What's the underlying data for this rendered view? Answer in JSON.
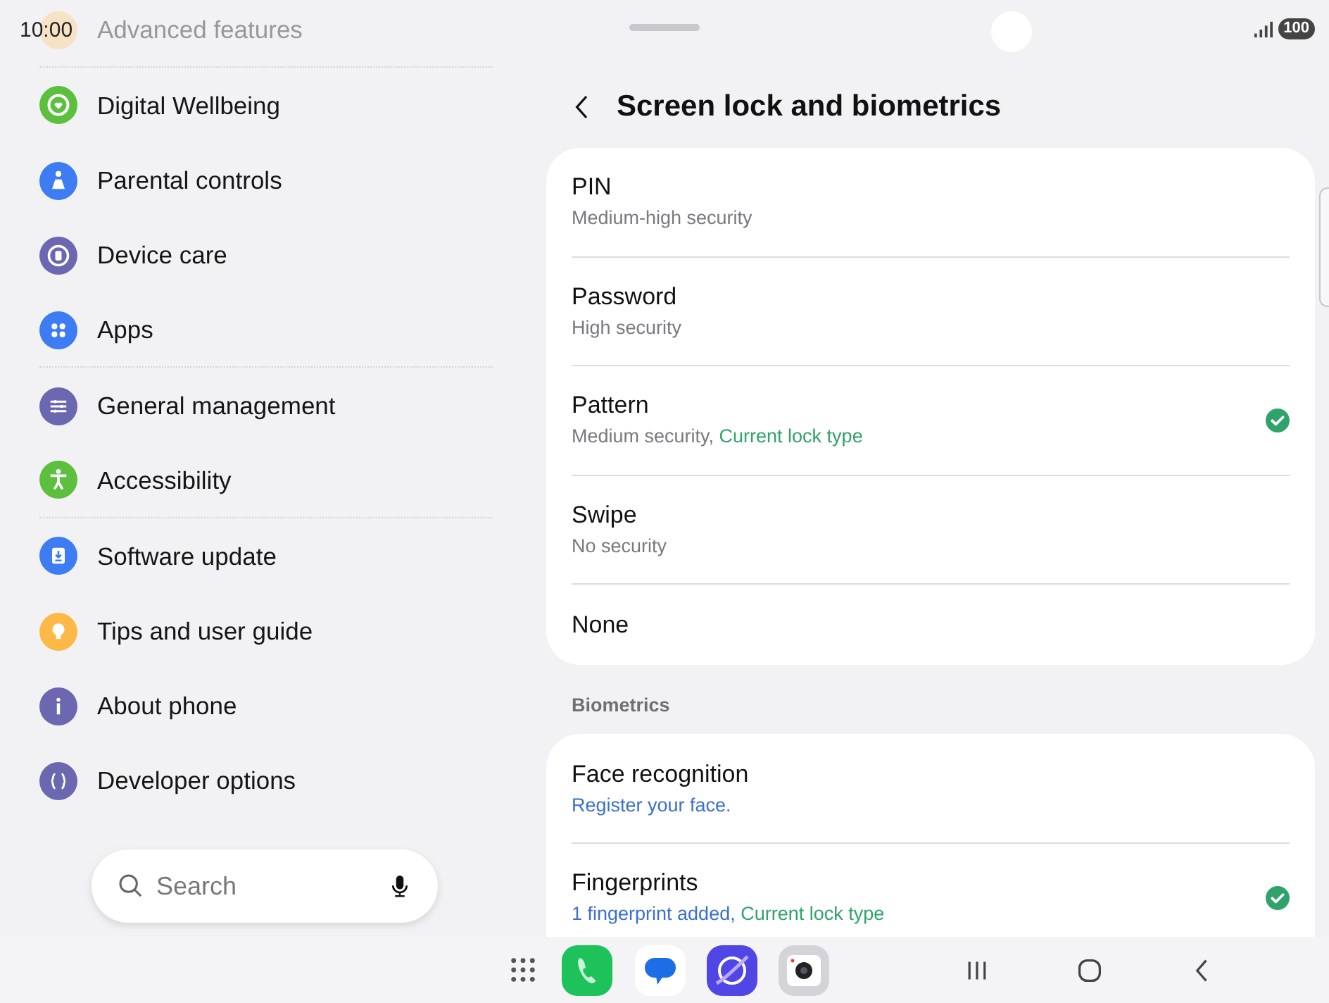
{
  "status_bar": {
    "time": "10:00",
    "battery": "100"
  },
  "sidebar": {
    "items": [
      {
        "label": "Advanced features",
        "color": "#f6e2c4",
        "faded": true,
        "divider_after": true
      },
      {
        "label": "Digital Wellbeing",
        "color": "#5cbf3d",
        "faded": false,
        "divider_after": false
      },
      {
        "label": "Parental controls",
        "color": "#3d7cf2",
        "faded": false,
        "divider_after": false
      },
      {
        "label": "Device care",
        "color": "#6b67b0",
        "faded": false,
        "divider_after": false
      },
      {
        "label": "Apps",
        "color": "#3d7cf2",
        "faded": false,
        "divider_after": true
      },
      {
        "label": "General management",
        "color": "#6b67b0",
        "faded": false,
        "divider_after": false
      },
      {
        "label": "Accessibility",
        "color": "#5cbf3d",
        "faded": false,
        "divider_after": true
      },
      {
        "label": "Software update",
        "color": "#3d7cf2",
        "faded": false,
        "divider_after": false
      },
      {
        "label": "Tips and user guide",
        "color": "#fdb948",
        "faded": false,
        "divider_after": false
      },
      {
        "label": "About phone",
        "color": "#6b67b0",
        "faded": false,
        "divider_after": false
      },
      {
        "label": "Developer options",
        "color": "#6b67b0",
        "faded": false,
        "divider_after": false
      }
    ],
    "search": {
      "placeholder": "Search"
    }
  },
  "page": {
    "title": "Screen lock and biometrics",
    "lock_types": [
      {
        "title": "PIN",
        "subtitle": [
          {
            "text": "Medium-high security",
            "color": "#7a7a7e"
          }
        ],
        "checked": false
      },
      {
        "title": "Password",
        "subtitle": [
          {
            "text": "High security",
            "color": "#7a7a7e"
          }
        ],
        "checked": false
      },
      {
        "title": "Pattern",
        "subtitle": [
          {
            "text": "Medium security, ",
            "color": "#7a7a7e"
          },
          {
            "text": "Current lock type",
            "color": "#2fa36a"
          }
        ],
        "checked": true
      },
      {
        "title": "Swipe",
        "subtitle": [
          {
            "text": "No security",
            "color": "#7a7a7e"
          }
        ],
        "checked": false
      },
      {
        "title": "None",
        "checked": false
      }
    ],
    "section_label": "Biometrics",
    "biometrics": [
      {
        "title": "Face recognition",
        "subtitle": [
          {
            "text": "Register your face.",
            "color": "#3b6fd0"
          }
        ],
        "checked": false
      },
      {
        "title": "Fingerprints",
        "subtitle": [
          {
            "text": "1 fingerprint added, ",
            "color": "#3b6fd0"
          },
          {
            "text": "Current lock type",
            "color": "#2fa36a"
          }
        ],
        "checked": true
      }
    ]
  }
}
